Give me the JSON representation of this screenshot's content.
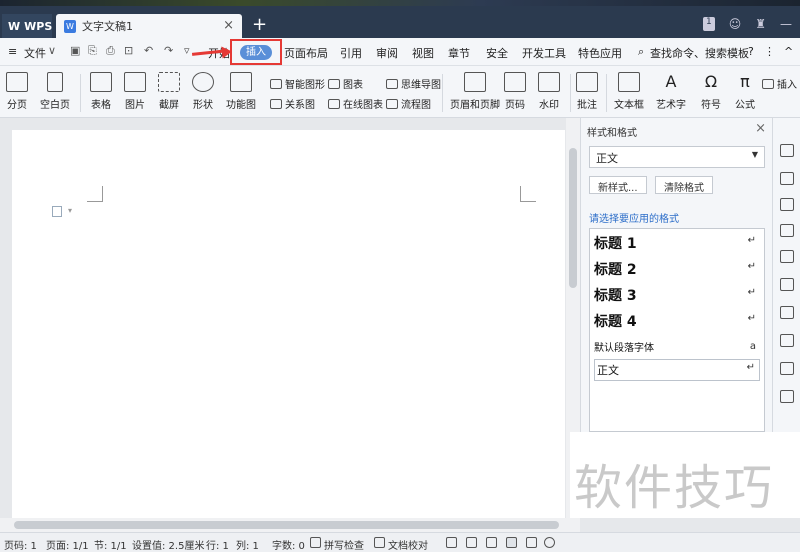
{
  "titlebar": {
    "app_tab": "WPS",
    "doc_tab": "文字文稿1",
    "new_tab": "+",
    "close": "×",
    "badge": "1"
  },
  "menubar": {
    "file": "文件",
    "items": [
      "开始",
      "插入",
      "页面布局",
      "引用",
      "审阅",
      "视图",
      "章节",
      "安全",
      "开发工具",
      "特色应用"
    ],
    "search": "查找命令、搜索模板",
    "help": "?",
    "more": "⋮",
    "collapse": "^"
  },
  "ribbon": {
    "page_break": "分页",
    "blank_page": "空白页",
    "table": "表格",
    "picture": "图片",
    "screenshot": "截屏",
    "shape": "形状",
    "function_chart": "功能图",
    "smart_graphic": "智能图形",
    "chart": "图表",
    "mind_map": "思维导图",
    "relation_chart": "关系图",
    "online_chart": "在线图表",
    "flow_chart": "流程图",
    "header_footer": "页眉和页脚",
    "page_number": "页码",
    "watermark": "水印",
    "comment": "批注",
    "text_box": "文本框",
    "art_text": "艺术字",
    "symbol": "符号",
    "formula": "公式",
    "insert_more": "插入"
  },
  "panel": {
    "title": "样式和格式",
    "close": "×",
    "current_style": "正文",
    "new_style": "新样式...",
    "clear_format": "清除格式",
    "choose_label": "请选择要应用的格式",
    "styles": [
      {
        "label": "标题 1",
        "mark": "↵"
      },
      {
        "label": "标题 2",
        "mark": "↵"
      },
      {
        "label": "标题 3",
        "mark": "↵"
      },
      {
        "label": "标题 4",
        "mark": "↵"
      },
      {
        "label": "默认段落字体",
        "mark": "a"
      },
      {
        "label": "正文",
        "mark": "↵"
      }
    ]
  },
  "watermark_text": "软件技巧",
  "status": {
    "page_num": "页码: 1",
    "pages": "页面: 1/1",
    "section": "节: 1/1",
    "setting": "设置值: 2.5厘米",
    "row": "行: 1",
    "col": "列: 1",
    "chars": "字数: 0",
    "spell": "拼写检查",
    "proof": "文档校对"
  }
}
